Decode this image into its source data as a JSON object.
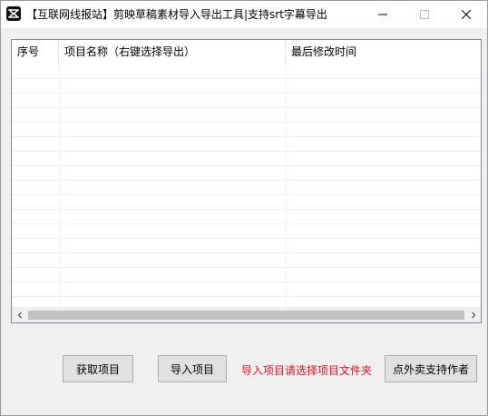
{
  "window": {
    "title": "【互联网线报站】剪映草稿素材导入导出工具|支持srt字幕导出"
  },
  "list": {
    "columns": [
      "序号",
      "项目名称（右键选择导出）",
      "最后修改时间"
    ],
    "rows": []
  },
  "actions": {
    "get_projects_label": "获取项目",
    "import_project_label": "导入项目",
    "import_hint": "导入项目请选择项目文件夹",
    "support_author_label": "点外卖支持作者"
  },
  "colors": {
    "hint": "#e81123",
    "window_bg": "#f0f0f0",
    "titlebar_bg": "#ffffff"
  },
  "icons": {
    "app": "capcut-icon",
    "minimize": "minimize-icon",
    "maximize": "maximize-icon",
    "close": "close-icon",
    "scroll_left": "chevron-left-icon",
    "scroll_right": "chevron-right-icon"
  }
}
